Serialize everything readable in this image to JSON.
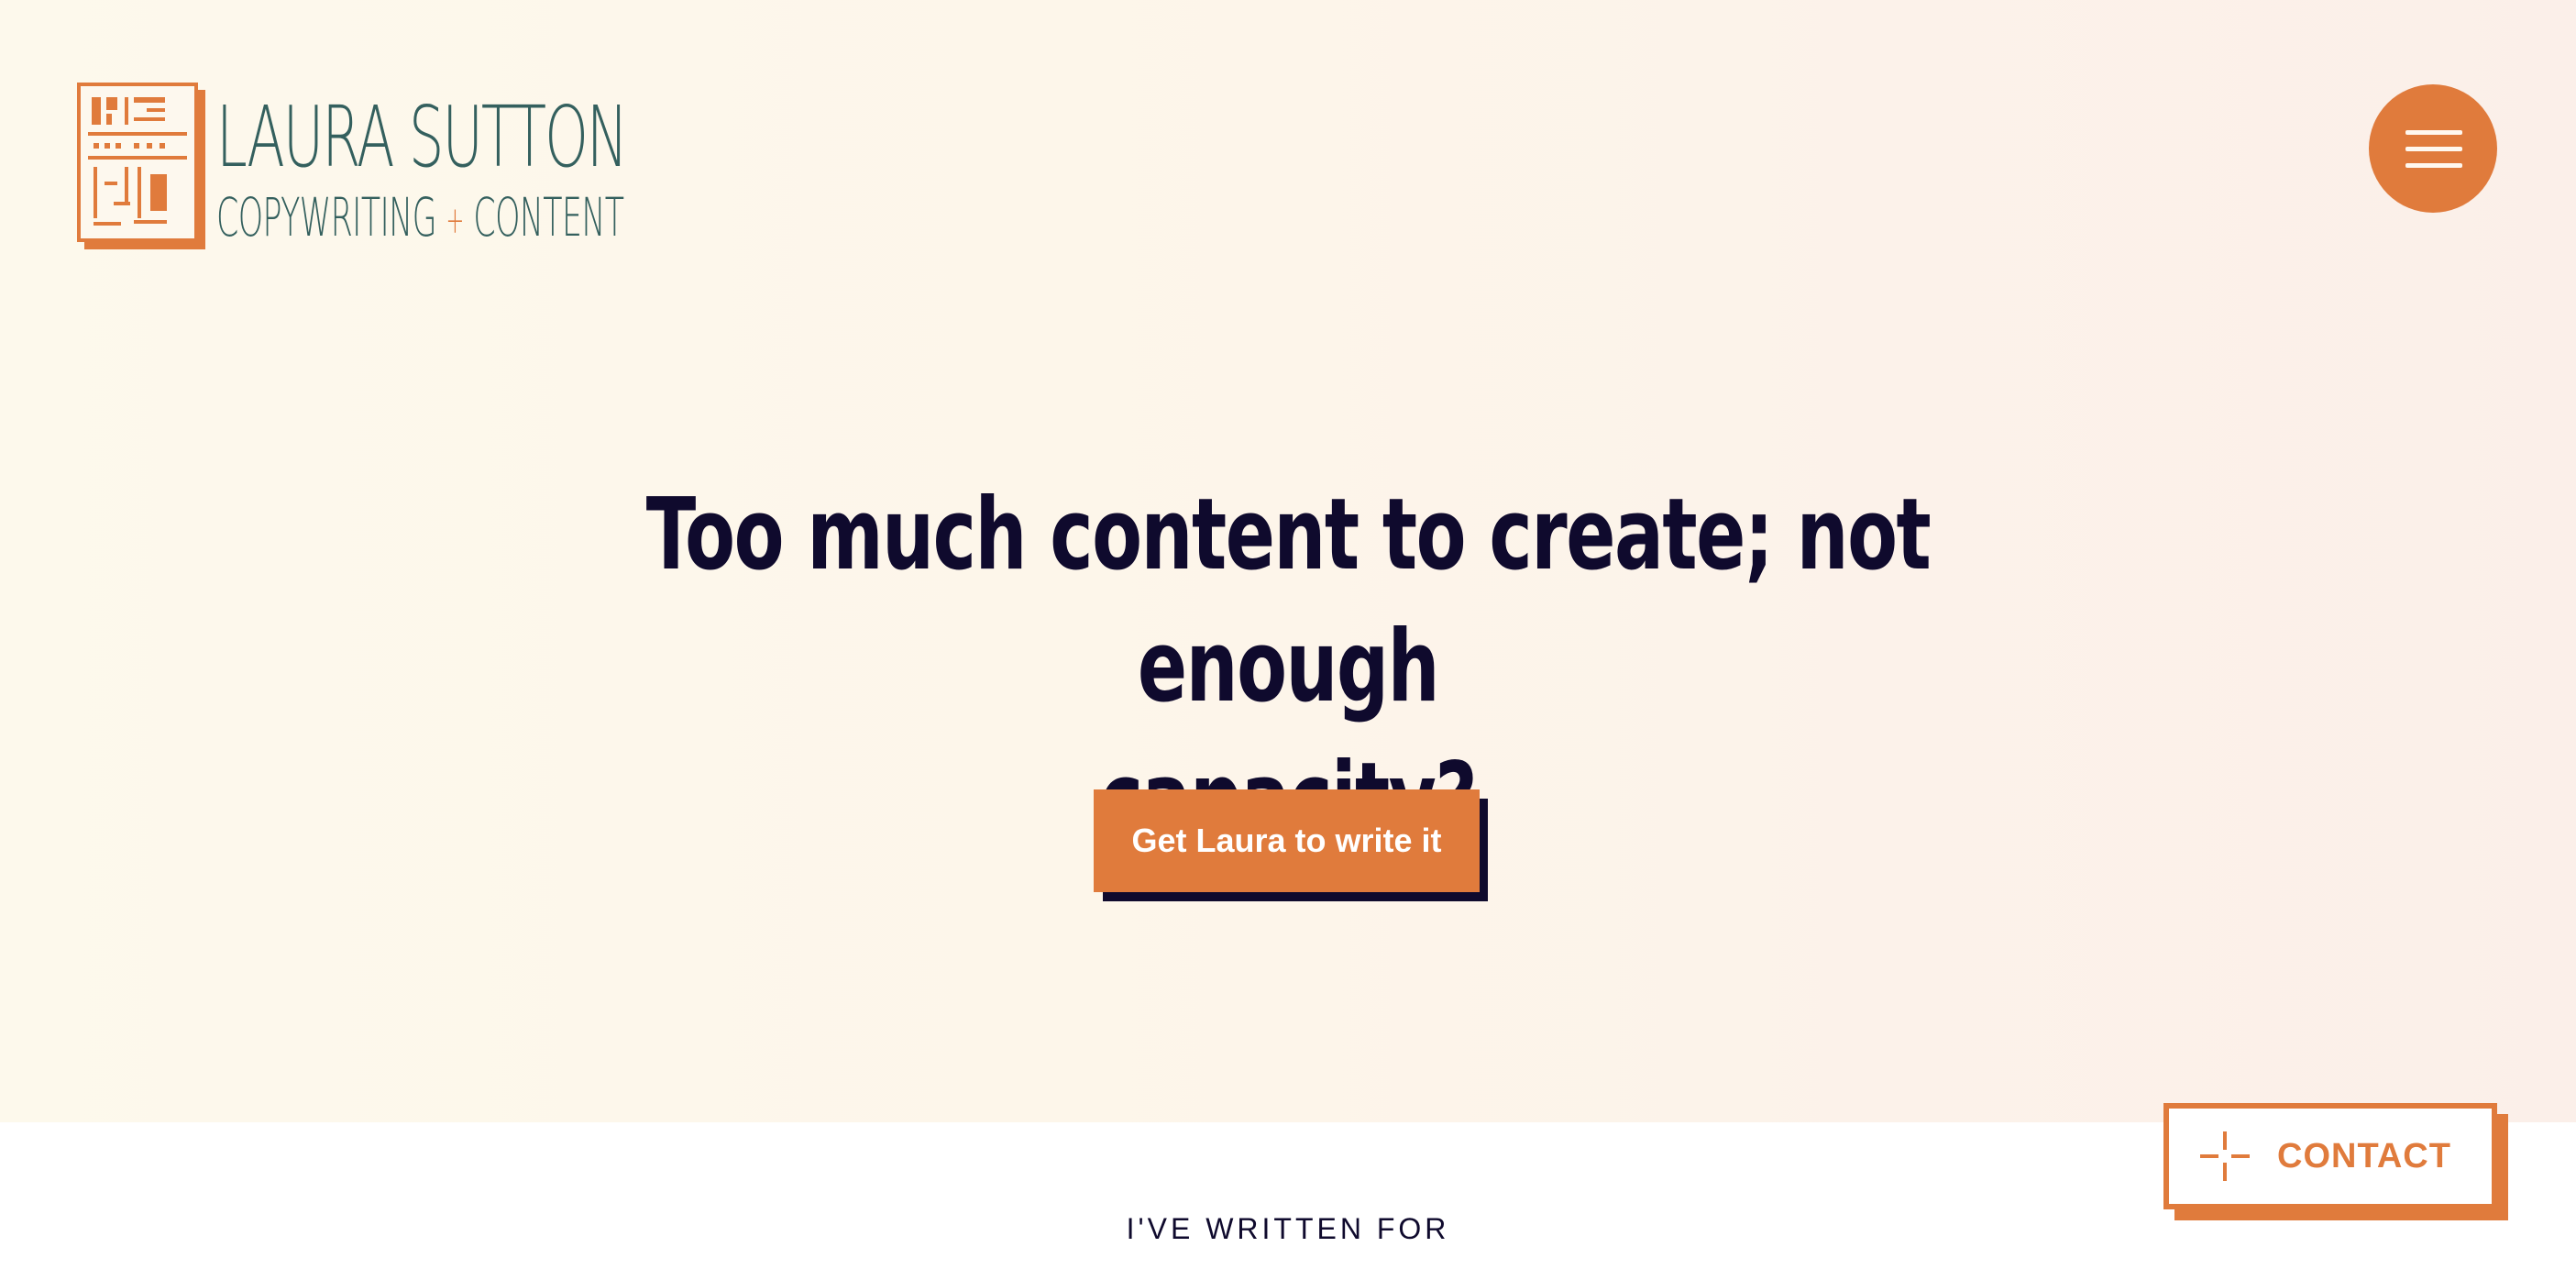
{
  "brand": {
    "name": "LAURA SUTTON",
    "tagline_left": "COPYWRITING",
    "tagline_sep": "+",
    "tagline_right": "CONTENT",
    "accent_color": "#e07b3c",
    "ink_color": "#0f0a2d",
    "logo_text_color": "#34605e"
  },
  "nav": {
    "menu_icon": "hamburger-icon"
  },
  "hero": {
    "headline_line1": "Too much content to create; not enough",
    "headline_line2": "capacity?",
    "cta_label": "Get Laura to write it"
  },
  "contact": {
    "icon": "crosshair-plus-icon",
    "label": "CONTACT"
  },
  "clients": {
    "heading": "I'VE WRITTEN FOR"
  }
}
